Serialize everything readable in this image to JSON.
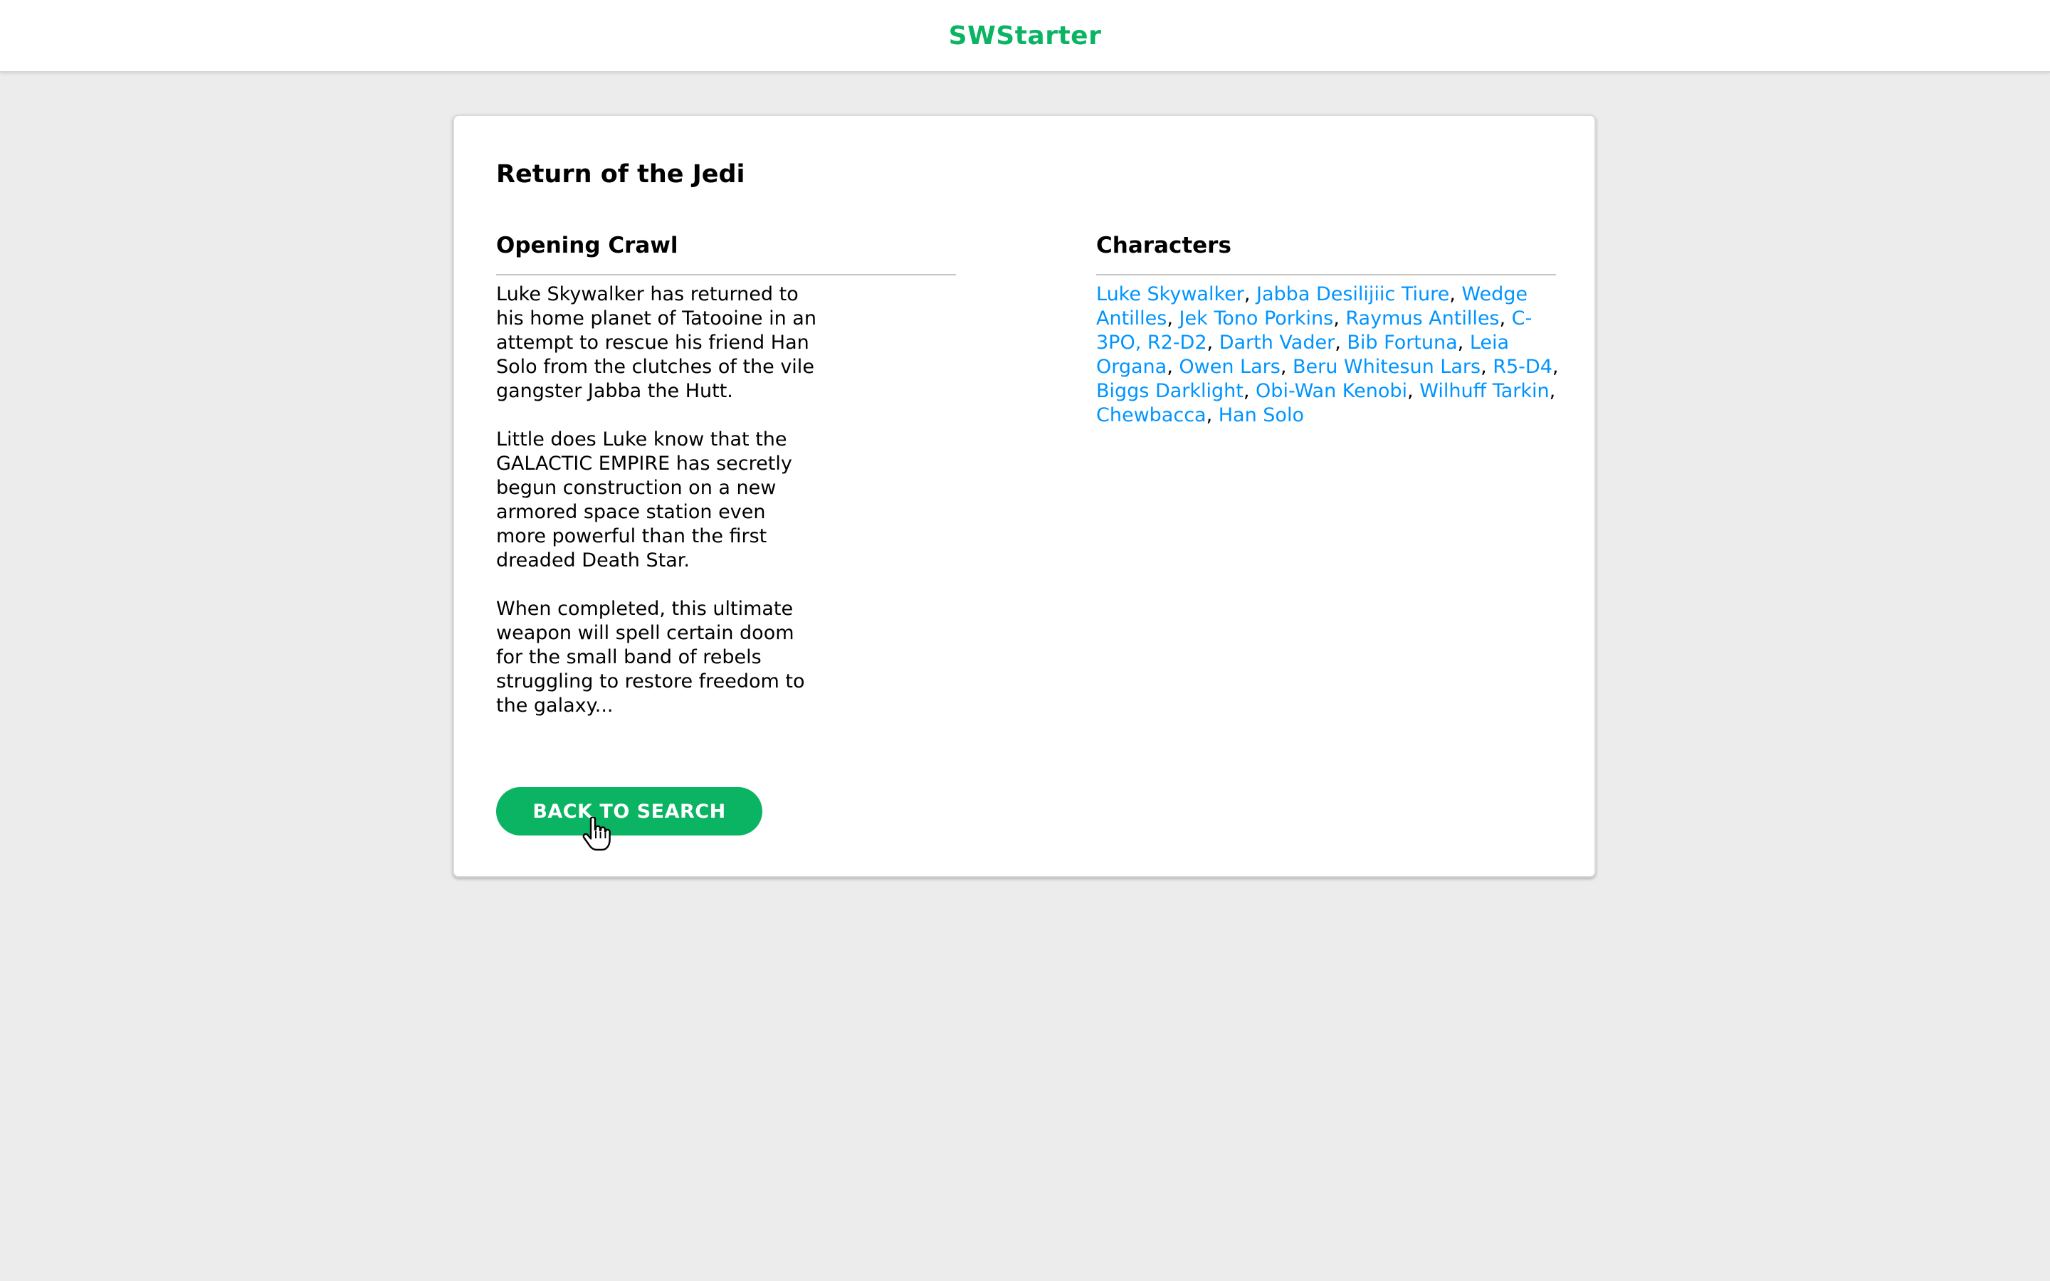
{
  "header": {
    "app_title": "SWStarter"
  },
  "film": {
    "title": "Return of the Jedi",
    "opening_crawl": {
      "heading": "Opening Crawl",
      "paragraphs": [
        "Luke Skywalker has returned to his home planet of Tatooine in an attempt to rescue his friend Han Solo from the clutches of the vile gangster Jabba the Hutt.",
        "Little does Luke know that the GALACTIC EMPIRE has secretly begun construction on a new armored space station even more powerful than the first dreaded Death Star.",
        "When completed, this ultimate weapon will spell certain doom for the small band of rebels struggling to restore freedom to the galaxy..."
      ]
    },
    "characters": {
      "heading": "Characters",
      "names": [
        "Luke Skywalker",
        "Jabba Desilijiic Tiure",
        "Wedge Antilles",
        "Jek Tono Porkins",
        "Raymus Antilles",
        "C-3PO, R2-D2",
        "Darth Vader",
        "Bib Fortuna",
        "Leia Organa",
        "Owen Lars",
        "Beru Whitesun Lars",
        "R5-D4",
        "Biggs Darklight",
        "Obi-Wan Kenobi",
        "Wilhuff Tarkin",
        "Chewbacca",
        "Han Solo"
      ],
      "separator": ", "
    }
  },
  "actions": {
    "back_label": "BACK TO SEARCH"
  },
  "colors": {
    "brand_green": "#0ab463",
    "link_blue": "#0094ff",
    "page_background": "#ececec"
  },
  "icons": {
    "cursor": "hand-pointer-icon"
  }
}
